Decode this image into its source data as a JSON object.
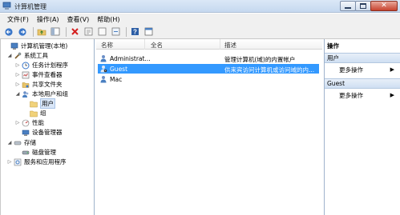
{
  "window": {
    "title": "计算机管理",
    "icon": "computer-management-icon"
  },
  "menu": [
    "文件(F)",
    "操作(A)",
    "查看(V)",
    "帮助(H)"
  ],
  "toolbar": [
    "back-icon",
    "forward-icon",
    "up-folder-icon",
    "show-hide-tree-icon",
    "delete-icon",
    "properties-icon",
    "refresh-icon",
    "export-icon",
    "help-icon",
    "console-icon"
  ],
  "tree": [
    {
      "label": "计算机管理(本地)",
      "icon": "computer-icon"
    },
    {
      "label": "系统工具",
      "icon": "tools-icon"
    },
    {
      "label": "任务计划程序",
      "icon": "clock-icon"
    },
    {
      "label": "事件查看器",
      "icon": "event-viewer-icon"
    },
    {
      "label": "共享文件夹",
      "icon": "shared-folder-icon"
    },
    {
      "label": "本地用户和组",
      "icon": "users-icon"
    },
    {
      "label": "用户",
      "icon": "folder-icon"
    },
    {
      "label": "组",
      "icon": "folder-icon"
    },
    {
      "label": "性能",
      "icon": "performance-icon"
    },
    {
      "label": "设备管理器",
      "icon": "device-manager-icon"
    },
    {
      "label": "存储",
      "icon": "storage-icon"
    },
    {
      "label": "磁盘管理",
      "icon": "disk-icon"
    },
    {
      "label": "服务和应用程序",
      "icon": "services-icon"
    }
  ],
  "list": {
    "columns": [
      "名称",
      "全名",
      "描述"
    ],
    "rows": [
      {
        "name": "Administrat...",
        "fullname": "",
        "description": "管理计算机(域)的内置帐户"
      },
      {
        "name": "Guest",
        "fullname": "",
        "description": "供来宾访问计算机或访问域的内..."
      },
      {
        "name": "Mac",
        "fullname": "",
        "description": ""
      }
    ]
  },
  "actions": {
    "title": "操作",
    "sections": [
      {
        "label": "用户",
        "item": "更多操作"
      },
      {
        "label": "Guest",
        "item": "更多操作"
      }
    ]
  },
  "colors": {
    "selection": "#3399ff",
    "title_bar": "#c5d8ef",
    "close_button": "#c7432e"
  }
}
